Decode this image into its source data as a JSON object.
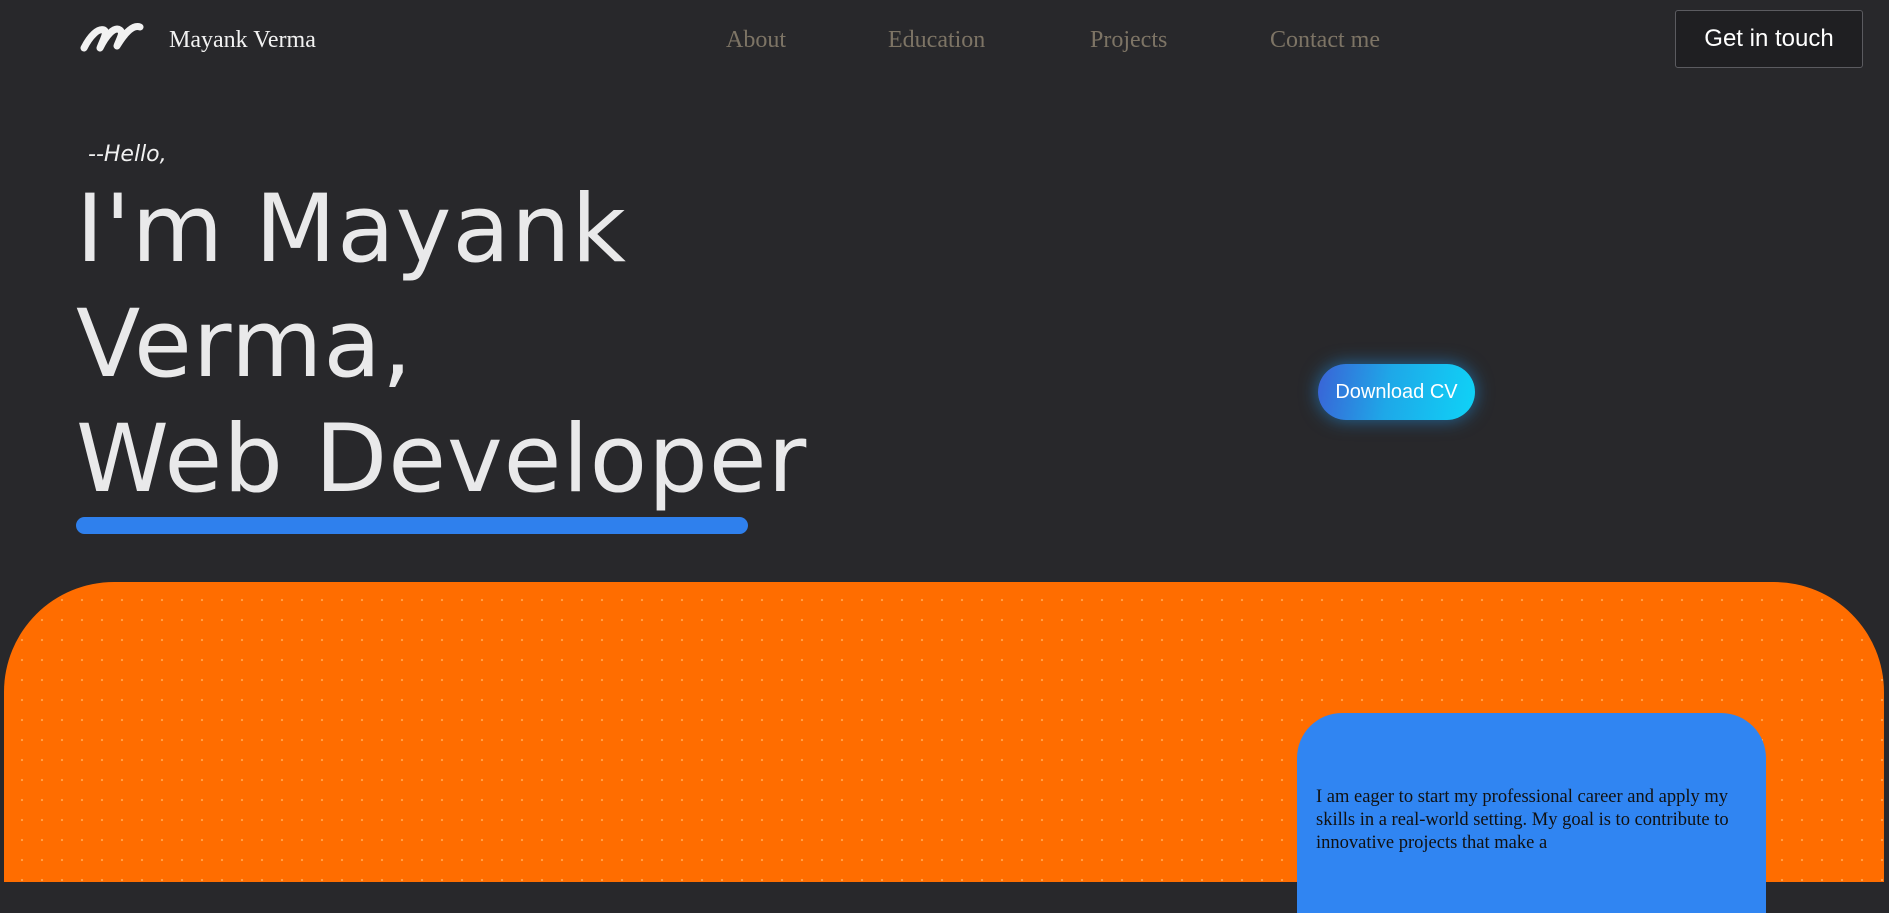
{
  "header": {
    "logo_icon": "script-m-logo-icon",
    "brand_name": "Mayank Verma",
    "nav": {
      "about": "About",
      "education": "Education",
      "projects": "Projects",
      "contact": "Contact me"
    },
    "cta_label": "Get in touch"
  },
  "hero": {
    "greeting": "--Hello,",
    "line1": "I'm Mayank",
    "line2": "Verma,",
    "line3": "Web Developer",
    "download_label": "Download CV"
  },
  "about": {
    "text": "I am eager to start my professional career and apply my skills in a real-world setting. My goal is to contribute to innovative projects that make a"
  },
  "colors": {
    "page_background": "#28282b",
    "accent_blue": "#2f80ed",
    "orange_section": "#ff6d00",
    "nav_link": "#7d7465",
    "download_gradient_start": "#3a62d6",
    "download_gradient_end": "#0fd3f7"
  }
}
